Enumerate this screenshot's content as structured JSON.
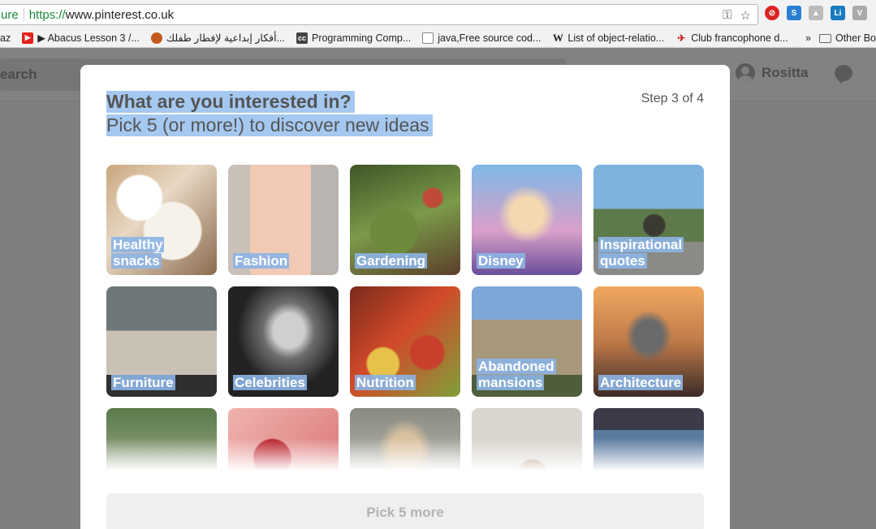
{
  "browser": {
    "url_secure": "ure",
    "url_proto": "https://",
    "url_host": "www.pinterest.co.uk",
    "bookmarks": [
      {
        "label": "az",
        "icon": "none"
      },
      {
        "label": "▶ Abacus Lesson 3 /...",
        "icon": "youtube-icon"
      },
      {
        "label": "أفكار إبداعية لإفطار طفلك...",
        "icon": "site-icon"
      },
      {
        "label": "Programming Comp...",
        "icon": "cc-icon"
      },
      {
        "label": "java,Free source cod...",
        "icon": "page-icon"
      },
      {
        "label": "List of object-relatio...",
        "icon": "wikipedia-icon"
      },
      {
        "label": "Club francophone d...",
        "icon": "site-icon"
      }
    ],
    "more_label": "»",
    "other_bookmarks": "Other Bo"
  },
  "header": {
    "search_label": "earch",
    "user_name": "Rositta"
  },
  "modal": {
    "title": "What are you interested in?",
    "subtitle": "Pick 5 (or more!) to discover new ideas",
    "step": "Step 3 of 4",
    "topics": [
      {
        "label": "Healthy snacks",
        "art": "t-snacks"
      },
      {
        "label": "Fashion",
        "art": "t-fashion"
      },
      {
        "label": "Gardening",
        "art": "t-garden"
      },
      {
        "label": "Disney",
        "art": "t-disney"
      },
      {
        "label": "Inspirational quotes",
        "art": "t-quotes"
      },
      {
        "label": "Furniture",
        "art": "t-furniture"
      },
      {
        "label": "Celebrities",
        "art": "t-celebs"
      },
      {
        "label": "Nutrition",
        "art": "t-nutrition"
      },
      {
        "label": "Abandoned mansions",
        "art": "t-mansions"
      },
      {
        "label": "Architecture",
        "art": "t-arch"
      },
      {
        "label": "",
        "art": "t-r1"
      },
      {
        "label": "",
        "art": "t-r2"
      },
      {
        "label": "",
        "art": "t-r3"
      },
      {
        "label": "",
        "art": "t-r4"
      },
      {
        "label": "",
        "art": "t-r5"
      }
    ],
    "button_label": "Pick 5 more"
  }
}
